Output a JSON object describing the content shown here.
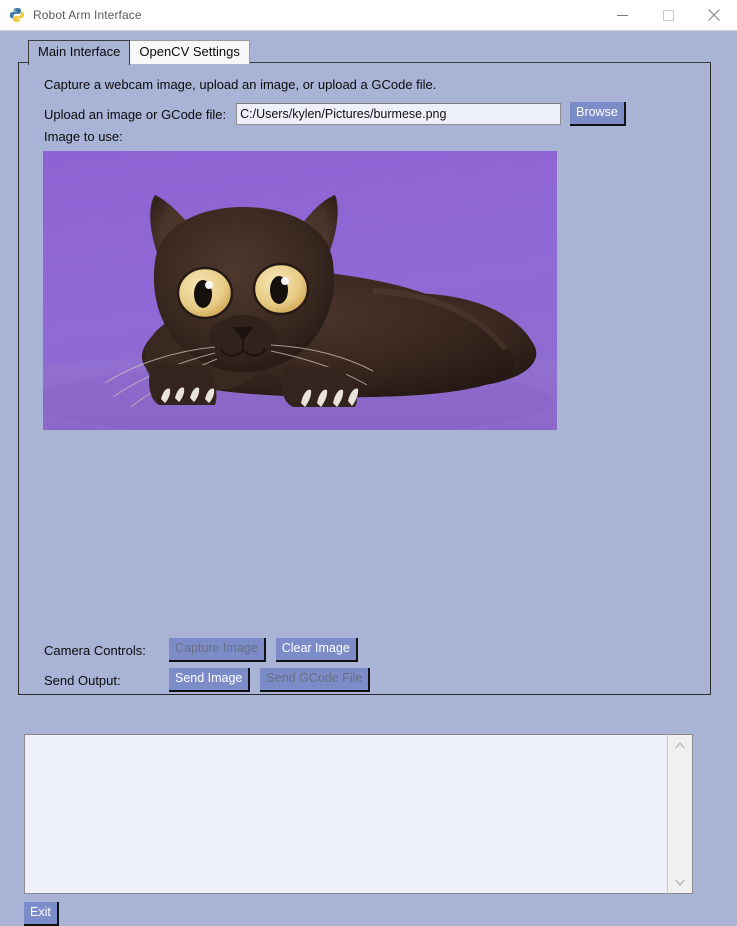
{
  "window": {
    "title": "Robot Arm Interface",
    "icon": "python-logo-icon",
    "controls": {
      "minimize": "minimize-icon",
      "maximize": "maximize-icon",
      "close": "close-icon"
    }
  },
  "tabs": [
    {
      "label": "Main Interface",
      "selected": true
    },
    {
      "label": "OpenCV Settings",
      "selected": false
    }
  ],
  "main": {
    "hint": "Capture a webcam image, upload an image, or upload a GCode file.",
    "upload": {
      "label": "Upload an image or GCode file:",
      "value": "C:/Users/kylen/Pictures/burmese.png",
      "placeholder": "",
      "browse_label": "Browse"
    },
    "image_label": "Image to use:",
    "preview": {
      "alt": "Burmese cat sitting on a purple background",
      "background_color": "#8f63d4",
      "cat_color": "#3b2a24"
    },
    "camera_controls": {
      "label": "Camera Controls:",
      "buttons": [
        {
          "label": "Capture Image",
          "enabled": false
        },
        {
          "label": "Clear Image",
          "enabled": true
        }
      ]
    },
    "send_output": {
      "label": "Send Output:",
      "buttons": [
        {
          "label": "Send Image",
          "enabled": true
        },
        {
          "label": "Send GCode File",
          "enabled": false
        }
      ]
    }
  },
  "console": {
    "value": "",
    "placeholder": "",
    "scrollbar": {
      "up": "chevron-up-icon",
      "down": "chevron-down-icon"
    }
  },
  "footer": {
    "exit_label": "Exit"
  },
  "colors": {
    "panel": "#a9b3d6",
    "button": "#7b8cc8",
    "field": "#eef1fa",
    "title_bar": "#ffffff"
  }
}
